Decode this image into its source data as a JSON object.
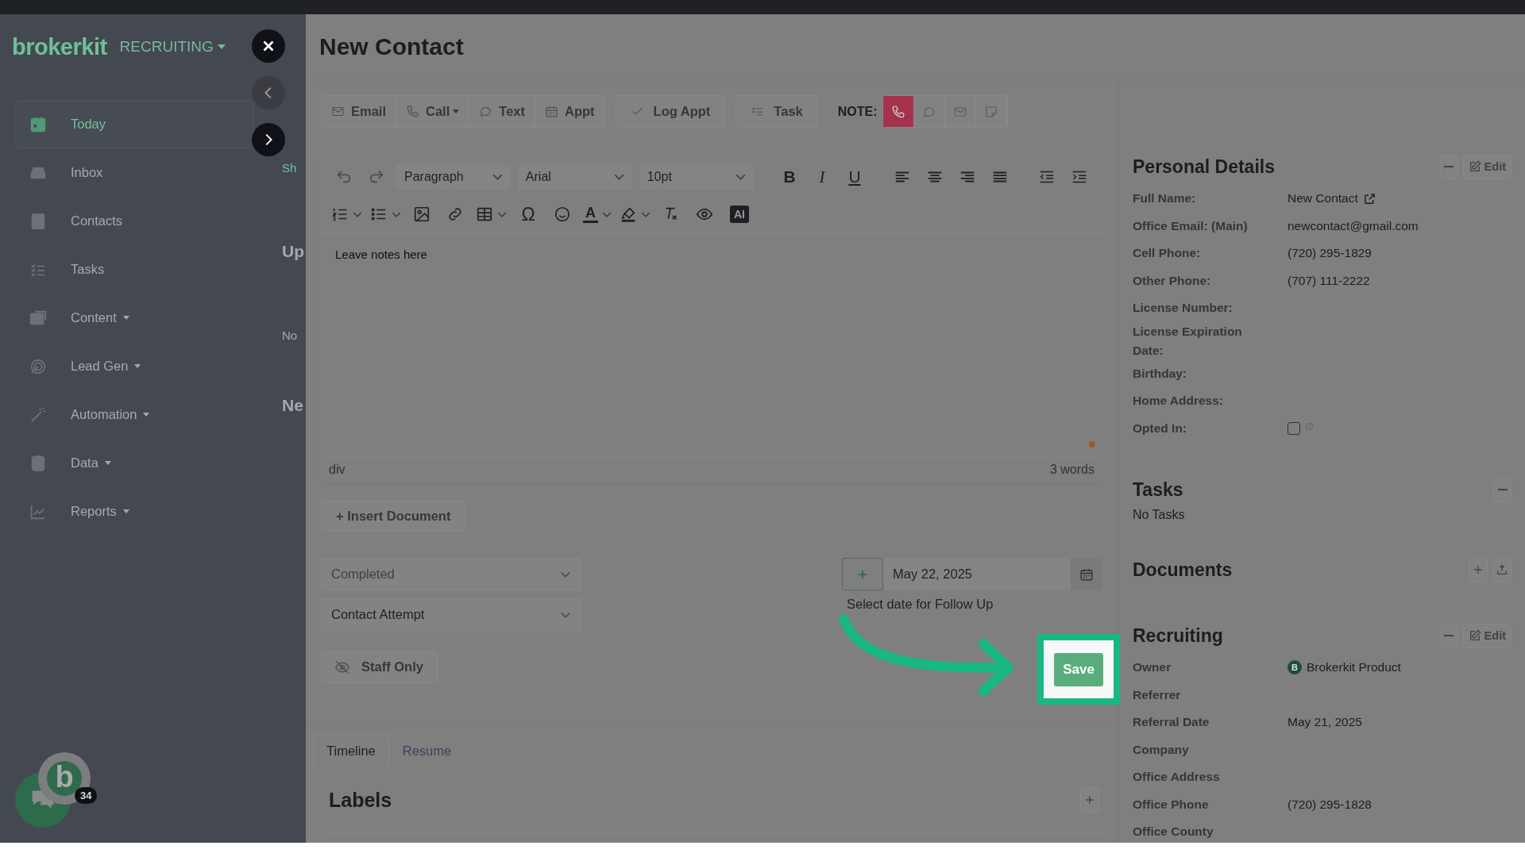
{
  "app": {
    "logo": "brokerkit",
    "workspace": "RECRUITING"
  },
  "sidebar": {
    "items": [
      {
        "kind": "today",
        "label": "Today",
        "selected": true,
        "dropdown": false
      },
      {
        "kind": "inbox",
        "label": "Inbox",
        "selected": false,
        "dropdown": false
      },
      {
        "kind": "contacts",
        "label": "Contacts",
        "selected": false,
        "dropdown": false
      },
      {
        "kind": "tasks",
        "label": "Tasks",
        "selected": false,
        "dropdown": false
      },
      {
        "kind": "content",
        "label": "Content",
        "selected": false,
        "dropdown": true
      },
      {
        "kind": "leadgen",
        "label": "Lead Gen",
        "selected": false,
        "dropdown": true
      },
      {
        "kind": "automation",
        "label": "Automation",
        "selected": false,
        "dropdown": true
      },
      {
        "kind": "data",
        "label": "Data",
        "selected": false,
        "dropdown": true
      },
      {
        "kind": "reports",
        "label": "Reports",
        "selected": false,
        "dropdown": true
      }
    ]
  },
  "page_behind": {
    "fragments": [
      "Sh",
      "Up",
      "No",
      "Ne"
    ]
  },
  "drawer": {
    "title": "New Contact",
    "action_groups": [
      {
        "items": [
          {
            "kind": "email",
            "label": "Email",
            "dropdown": false
          },
          {
            "kind": "call",
            "label": "Call",
            "dropdown": true
          },
          {
            "kind": "text",
            "label": "Text",
            "dropdown": false
          },
          {
            "kind": "appt",
            "label": "Appt",
            "dropdown": false
          }
        ]
      },
      {
        "items": [
          {
            "kind": "log",
            "label": "Log Appt",
            "dropdown": false
          }
        ]
      },
      {
        "items": [
          {
            "kind": "task",
            "label": "Task",
            "dropdown": false
          }
        ]
      }
    ],
    "note": {
      "label": "NOTE:",
      "types": [
        {
          "kind": "call",
          "selected": true
        },
        {
          "kind": "text",
          "selected": false
        },
        {
          "kind": "email",
          "selected": false
        },
        {
          "kind": "note",
          "selected": false
        }
      ]
    },
    "editor": {
      "block_format": "Paragraph",
      "font": "Arial",
      "size": "10pt",
      "style_buttons": [
        "B",
        "I",
        "U"
      ],
      "special_char": "Ω",
      "font_color": "A",
      "ai": "AI",
      "content": "Leave notes here",
      "path": "div",
      "word_count": "3 words"
    },
    "insert_document": "+ Insert Document",
    "status_select": {
      "value": "Completed",
      "muted": true
    },
    "type_select": {
      "value": "Contact Attempt",
      "muted": false
    },
    "follow_up": {
      "date": "May 22, 2025",
      "hint": "Select date for Follow Up"
    },
    "staff_only": "Staff Only",
    "save": "Save",
    "tabs": [
      {
        "label": "Timeline",
        "selected": true
      },
      {
        "label": "Resume",
        "selected": false
      }
    ],
    "labels_heading": "Labels"
  },
  "details": {
    "personal": {
      "title": "Personal Details",
      "edit": "Edit",
      "rows": [
        {
          "kind": "link",
          "label": "Full Name:",
          "value": "New Contact"
        },
        {
          "kind": "text",
          "label": "Office Email: (Main)",
          "value": "newcontact@gmail.com"
        },
        {
          "kind": "text",
          "label": "Cell Phone:",
          "value": "(720) 295-1829"
        },
        {
          "kind": "text",
          "label": "Other Phone:",
          "value": "(707) 111-2222"
        },
        {
          "kind": "text",
          "label": "License Number:"
        },
        {
          "kind": "text",
          "label": "License Expiration Date:"
        },
        {
          "kind": "text",
          "label": "Birthday:"
        },
        {
          "kind": "text",
          "label": "Home Address:"
        },
        {
          "kind": "checkbox",
          "label": "Opted In:",
          "checked": false
        }
      ]
    },
    "tasks": {
      "title": "Tasks",
      "empty": "No Tasks"
    },
    "documents": {
      "title": "Documents"
    },
    "recruiting": {
      "title": "Recruiting",
      "edit": "Edit",
      "rows": [
        {
          "kind": "owner",
          "label": "Owner",
          "value": "Brokerkit Product",
          "avatar": "B"
        },
        {
          "kind": "text",
          "label": "Referrer"
        },
        {
          "kind": "text",
          "label": "Referral Date",
          "value": "May 21, 2025"
        },
        {
          "kind": "text",
          "label": "Company"
        },
        {
          "kind": "text",
          "label": "Office Address"
        },
        {
          "kind": "text",
          "label": "Office Phone",
          "value": "(720) 295-1828"
        },
        {
          "kind": "text",
          "label": "Office County"
        }
      ]
    }
  },
  "chat_widget": {
    "logo": "b",
    "badge": "34"
  }
}
